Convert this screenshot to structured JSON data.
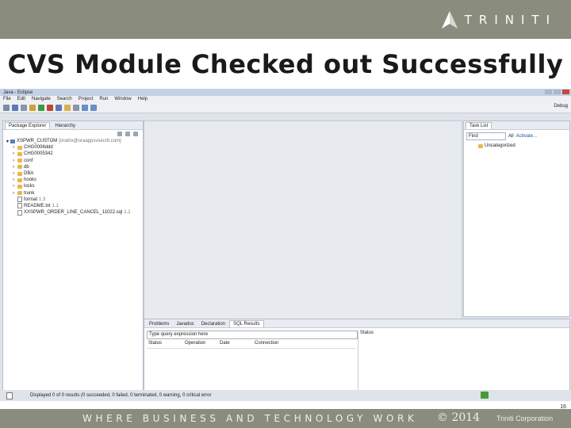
{
  "brand": {
    "name": "TRINITI"
  },
  "slide": {
    "title": "CVS Module Checked out Successfully",
    "page_number": "16"
  },
  "footer": {
    "tagline": "WHERE BUSINESS AND TECHNOLOGY WORK",
    "year": "2014",
    "copyright_symbol": "©",
    "company": "Triniti Corporation"
  },
  "eclipse": {
    "window_title": "Java - Eclipse",
    "menu": [
      "File",
      "Edit",
      "Navigate",
      "Search",
      "Project",
      "Run",
      "Window",
      "Help"
    ],
    "perspective": "Debug",
    "package_explorer": {
      "tabs": [
        "Package Explorer",
        "Hierarchy"
      ],
      "root": {
        "name": "XSPWR_CUSTOM",
        "host": "[oratrix@oraappsvsecrb.com]"
      },
      "items": [
        {
          "name": "CHG0006ddd",
          "type": "folder",
          "meta": ""
        },
        {
          "name": "CHG0005342",
          "type": "folder",
          "meta": ""
        },
        {
          "name": "conf",
          "type": "folder",
          "meta": ""
        },
        {
          "name": "db",
          "type": "folder",
          "meta": ""
        },
        {
          "name": "DBA",
          "type": "folder",
          "meta": ""
        },
        {
          "name": "hooks",
          "type": "folder",
          "meta": ""
        },
        {
          "name": "locks",
          "type": "folder",
          "meta": ""
        },
        {
          "name": "trunk",
          "type": "folder",
          "meta": ""
        },
        {
          "name": "format",
          "type": "file",
          "meta": "1.3"
        },
        {
          "name": "README.txt",
          "type": "file",
          "meta": "1.1"
        },
        {
          "name": "XXSPWR_ORDER_LINE_CANCEL_11022.sql",
          "type": "file",
          "meta": "1.1"
        }
      ]
    },
    "task_list": {
      "tab": "Task List",
      "find_placeholder": "Find",
      "all_label": "All",
      "activate_label": "Activate...",
      "category": "Uncategorized"
    },
    "bottom_panel": {
      "tabs": [
        "Problems",
        "Javadoc",
        "Declaration",
        "SQL Results"
      ],
      "query_placeholder": "Type query expression here",
      "columns": [
        "Status",
        "Operation",
        "Date",
        "Connection"
      ],
      "status_header": "Status"
    },
    "status_message": "Displayed 0 of 0 results (0 succeeded, 0 failed, 0 terminated, 0 warning, 0 critical error"
  }
}
